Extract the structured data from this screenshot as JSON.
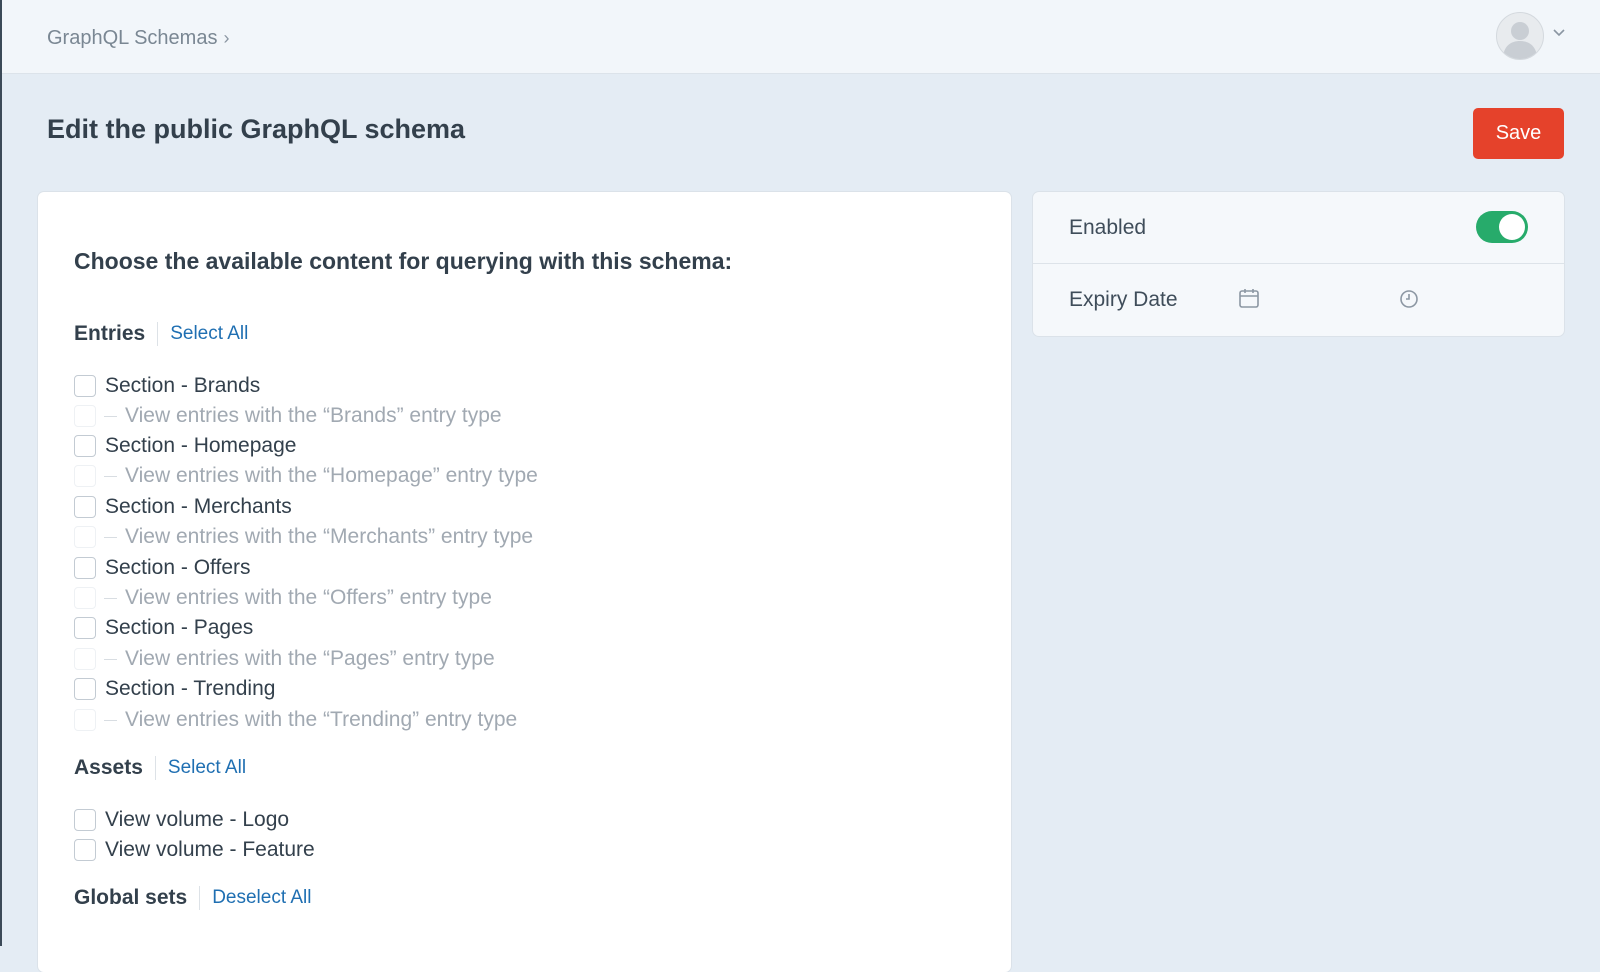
{
  "breadcrumb": {
    "label": "GraphQL Schemas",
    "separator": "›"
  },
  "header": {
    "title": "Edit the public GraphQL schema",
    "save_label": "Save"
  },
  "colors": {
    "accent": "#e5422b",
    "link": "#1f6fb2",
    "toggle_on": "#27ab6b"
  },
  "content": {
    "prompt": "Choose the available content for querying with this schema:",
    "entries": {
      "title": "Entries",
      "action": "Select All",
      "items": [
        {
          "label": "Section - Brands",
          "sub": "View entries with the “Brands” entry type"
        },
        {
          "label": "Section - Homepage",
          "sub": "View entries with the “Homepage” entry type"
        },
        {
          "label": "Section - Merchants",
          "sub": "View entries with the “Merchants” entry type"
        },
        {
          "label": "Section - Offers",
          "sub": "View entries with the “Offers” entry type"
        },
        {
          "label": "Section - Pages",
          "sub": "View entries with the “Pages” entry type"
        },
        {
          "label": "Section - Trending",
          "sub": "View entries with the “Trending” entry type"
        }
      ]
    },
    "assets": {
      "title": "Assets",
      "action": "Select All",
      "items": [
        "View volume - Logo",
        "View volume - Feature"
      ]
    },
    "global_sets": {
      "title": "Global sets",
      "action": "Deselect All"
    }
  },
  "settings": {
    "enabled_label": "Enabled",
    "enabled": true,
    "expiry_label": "Expiry Date",
    "date_icon": "calendar-icon",
    "time_icon": "clock-icon"
  }
}
